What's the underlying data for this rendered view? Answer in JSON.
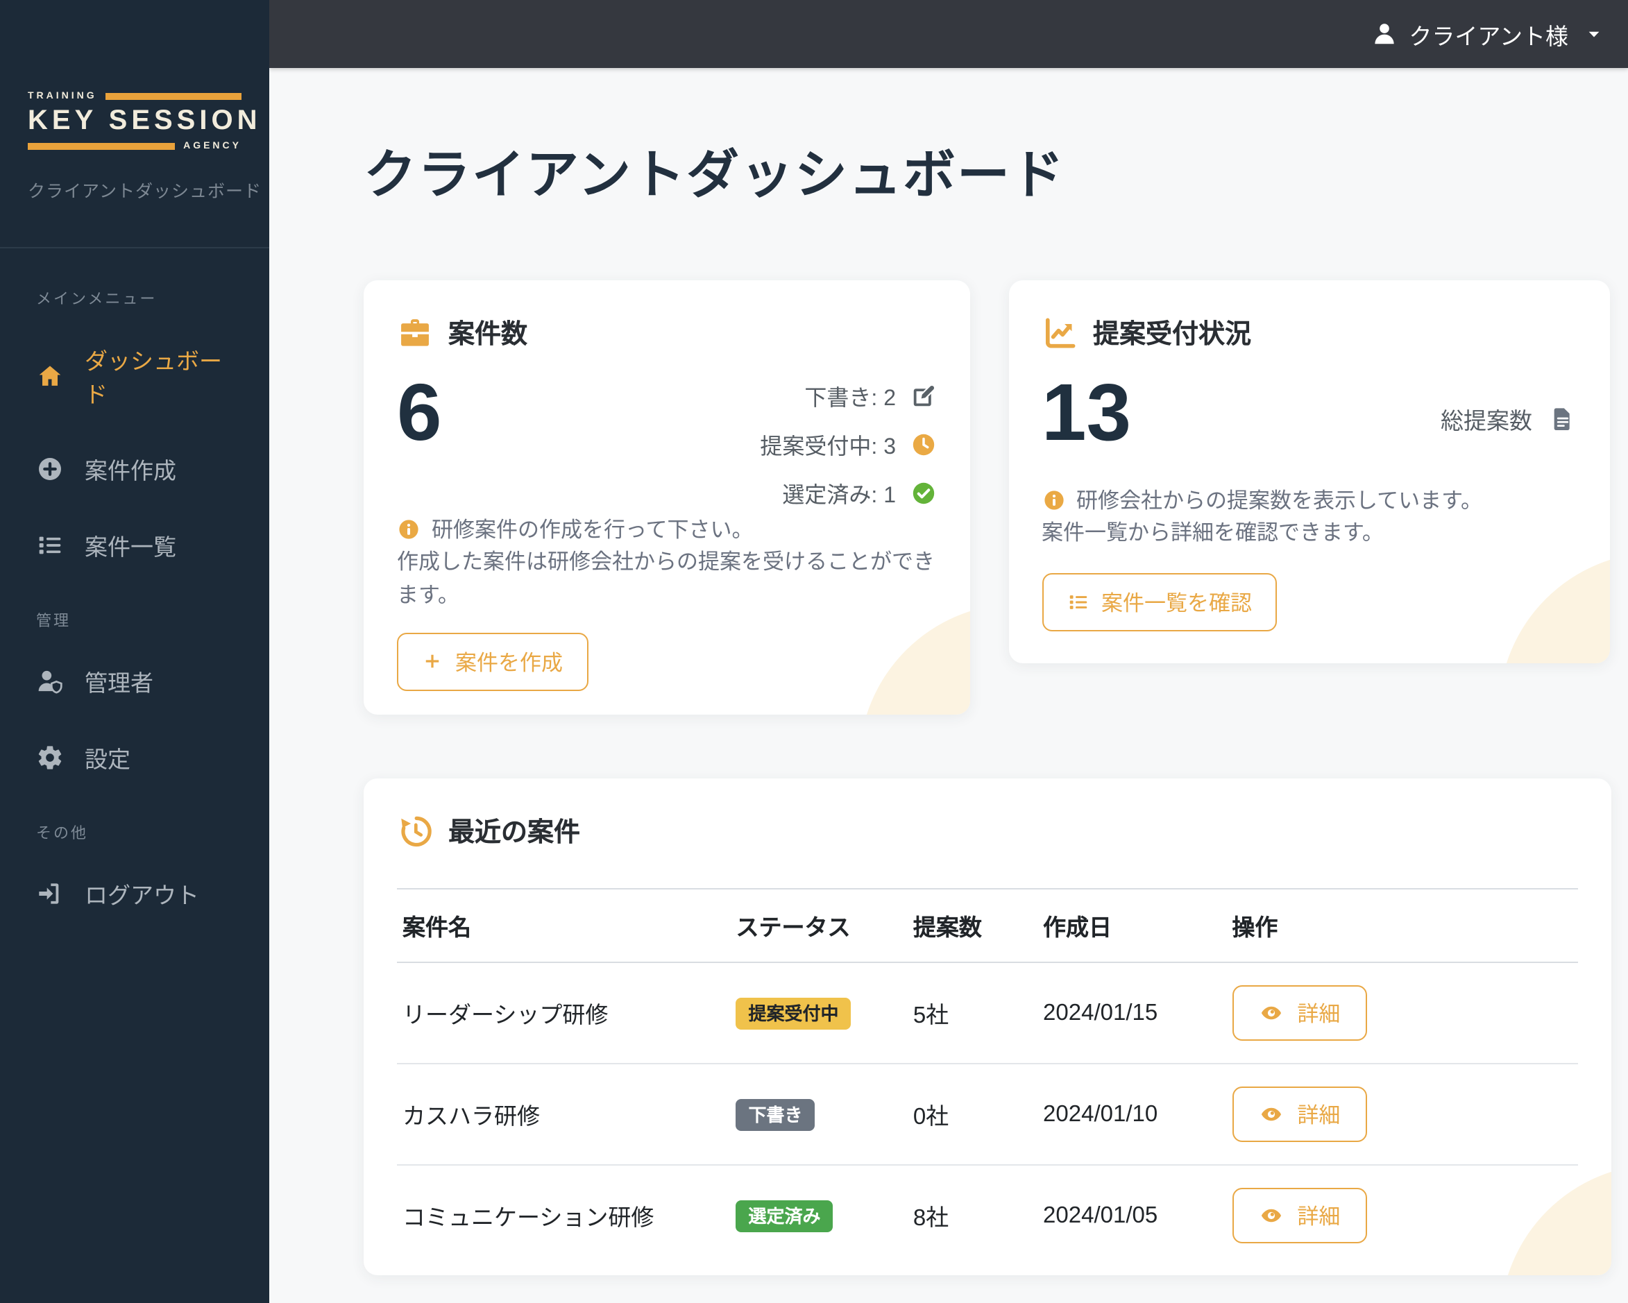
{
  "topbar": {
    "user_label": "クライアント様"
  },
  "sidebar": {
    "logo": {
      "top": "TRAINING",
      "name": "KEY SESSION",
      "bottom": "AGENCY"
    },
    "subtitle": "クライアントダッシュボード",
    "sections": [
      {
        "label": "メインメニュー",
        "items": [
          {
            "label": "ダッシュボード",
            "icon": "home",
            "active": true
          },
          {
            "label": "案件作成",
            "icon": "plus-circle",
            "active": false
          },
          {
            "label": "案件一覧",
            "icon": "list",
            "active": false
          }
        ]
      },
      {
        "label": "管理",
        "items": [
          {
            "label": "管理者",
            "icon": "user-shield",
            "active": false
          },
          {
            "label": "設定",
            "icon": "gear",
            "active": false
          }
        ]
      },
      {
        "label": "その他",
        "items": [
          {
            "label": "ログアウト",
            "icon": "sign-out",
            "active": false
          }
        ]
      }
    ]
  },
  "page": {
    "title": "クライアントダッシュボード"
  },
  "cards": {
    "cases": {
      "title": "案件数",
      "count": "6",
      "stats": [
        {
          "text": "下書き: 2",
          "icon": "edit"
        },
        {
          "text": "提案受付中: 3",
          "icon": "clock"
        },
        {
          "text": "選定済み: 1",
          "icon": "check-circle"
        }
      ],
      "info_line1": "研修案件の作成を行って下さい。",
      "info_line2": "作成した案件は研修会社からの提案を受けることができます。",
      "button_label": "案件を作成"
    },
    "proposals": {
      "title": "提案受付状況",
      "count": "13",
      "total_label": "総提案数",
      "info_line1": "研修会社からの提案数を表示しています。",
      "info_line2": "案件一覧から詳細を確認できます。",
      "button_label": "案件一覧を確認"
    }
  },
  "recent": {
    "title": "最近の案件",
    "columns": [
      "案件名",
      "ステータス",
      "提案数",
      "作成日",
      "操作"
    ],
    "rows": [
      {
        "name": "リーダーシップ研修",
        "status": "提案受付中",
        "status_type": "warning",
        "proposals": "5社",
        "date": "2024/01/15",
        "action": "詳細"
      },
      {
        "name": "カスハラ研修",
        "status": "下書き",
        "status_type": "secondary",
        "proposals": "0社",
        "date": "2024/01/10",
        "action": "詳細"
      },
      {
        "name": "コミュニケーション研修",
        "status": "選定済み",
        "status_type": "success",
        "proposals": "8社",
        "date": "2024/01/05",
        "action": "詳細"
      }
    ]
  },
  "colors": {
    "accent": "#E9A845",
    "sidebar_bg": "#1C2A38",
    "topbar_bg": "#35383F",
    "heading": "#22303F",
    "badge_warning": "#F0C24B",
    "badge_secondary": "#6B7480",
    "badge_success": "#4AA64D",
    "success_icon": "#63B339",
    "info_icon": "#EAA944",
    "card_blob": "#FCF3E1",
    "page_bg": "#F7F8F9"
  }
}
